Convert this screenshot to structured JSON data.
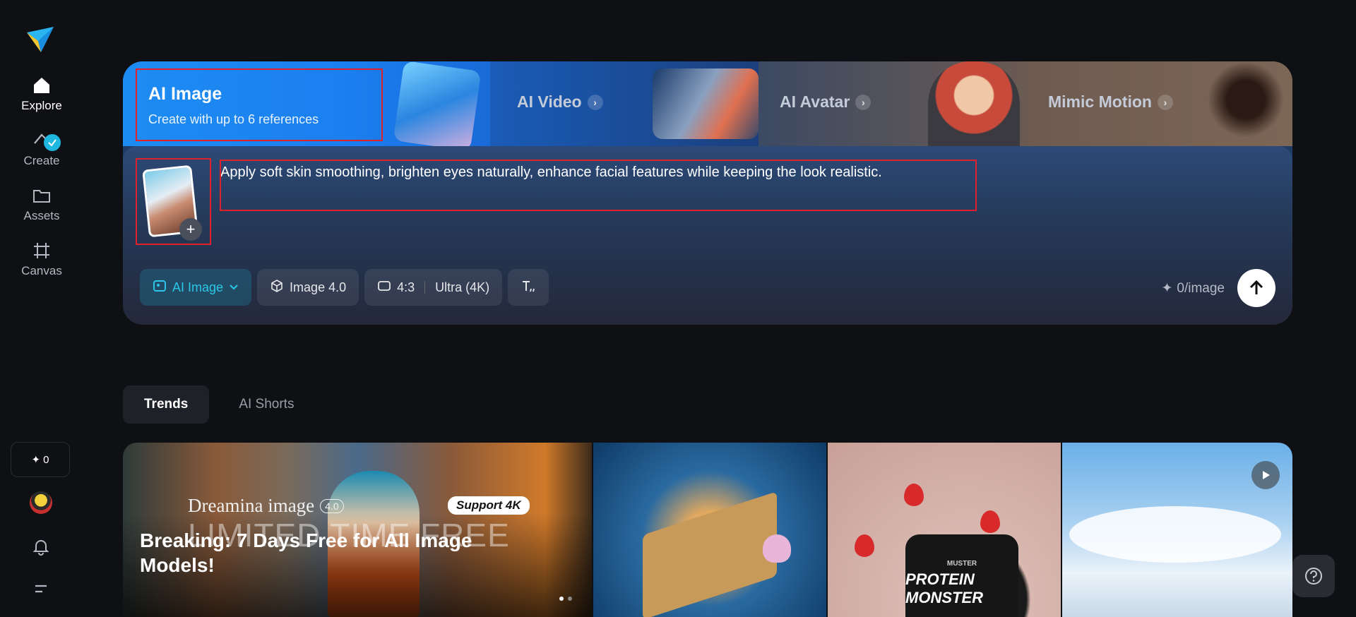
{
  "sidebar": {
    "items": [
      {
        "label": "Explore",
        "icon": "home-icon",
        "active": true
      },
      {
        "label": "Create",
        "icon": "create-icon"
      },
      {
        "label": "Assets",
        "icon": "folder-icon"
      },
      {
        "label": "Canvas",
        "icon": "canvas-icon"
      }
    ],
    "credits": "0"
  },
  "hero": {
    "tabs": [
      {
        "title": "AI Image",
        "subtitle": "Create with up to 6 references"
      },
      {
        "title": "AI Video"
      },
      {
        "title": "AI Avatar"
      },
      {
        "title": "Mimic Motion"
      }
    ],
    "prompt": "Apply soft skin smoothing, brighten eyes naturally, enhance facial features while keeping the look realistic.",
    "toolbar": {
      "mode": "AI Image",
      "model": "Image 4.0",
      "ratio": "4:3",
      "quality": "Ultra (4K)"
    },
    "cost": "0/image"
  },
  "section_tabs": [
    "Trends",
    "AI Shorts"
  ],
  "gallery": {
    "feature": {
      "brand": "Dreamina image",
      "version": "4.0",
      "badge": "Support 4K",
      "overlay": "LIMITED TIME FREE",
      "headline": "Breaking: 7 Days Free for All Image Models!"
    },
    "jar_label": "PROTEIN MONSTER",
    "jar_brand": "MUSTER"
  },
  "colors": {
    "accent": "#2cc6e6",
    "highlight": "#e0202a",
    "background": "#0f1014"
  }
}
